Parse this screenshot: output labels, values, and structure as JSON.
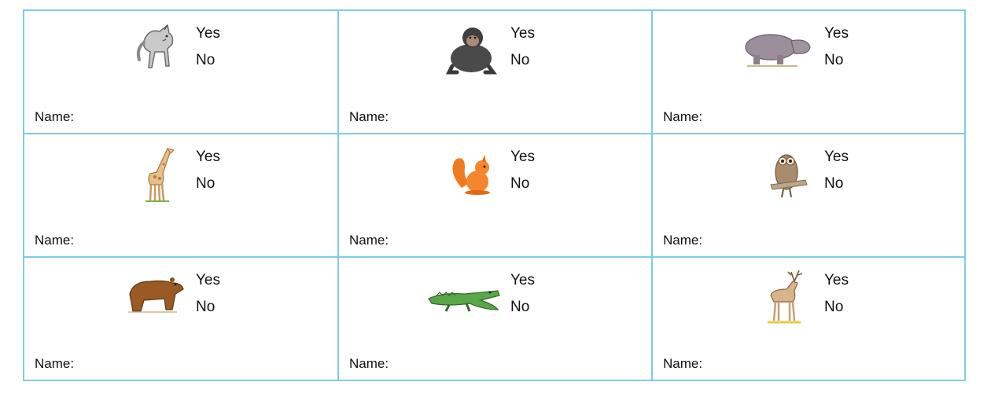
{
  "cards": [
    {
      "animal_icon": "wolf-icon",
      "yes_label": "Yes",
      "no_label": "No",
      "name_label": "Name:"
    },
    {
      "animal_icon": "chimpanzee-icon",
      "yes_label": "Yes",
      "no_label": "No",
      "name_label": "Name:"
    },
    {
      "animal_icon": "hippo-icon",
      "yes_label": "Yes",
      "no_label": "No",
      "name_label": "Name:"
    },
    {
      "animal_icon": "giraffe-icon",
      "yes_label": "Yes",
      "no_label": "No",
      "name_label": "Name:"
    },
    {
      "animal_icon": "squirrel-icon",
      "yes_label": "Yes",
      "no_label": "No",
      "name_label": "Name:"
    },
    {
      "animal_icon": "owl-icon",
      "yes_label": "Yes",
      "no_label": "No",
      "name_label": "Name:"
    },
    {
      "animal_icon": "bear-icon",
      "yes_label": "Yes",
      "no_label": "No",
      "name_label": "Name:"
    },
    {
      "animal_icon": "crocodile-icon",
      "yes_label": "Yes",
      "no_label": "No",
      "name_label": "Name:"
    },
    {
      "animal_icon": "deer-icon",
      "yes_label": "Yes",
      "no_label": "No",
      "name_label": "Name:"
    }
  ],
  "colors": {
    "border": "#7fcbe8",
    "text": "#111111"
  }
}
